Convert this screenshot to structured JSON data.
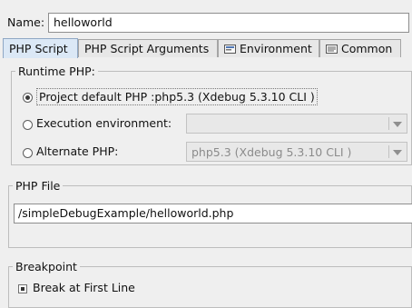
{
  "name_row": {
    "label": "Name:",
    "value": "helloworld"
  },
  "tabs": [
    {
      "label": "PHP Script",
      "icon": "php-script-icon",
      "active": true
    },
    {
      "label": "PHP Script Arguments",
      "icon": "",
      "active": false
    },
    {
      "label": "Environment",
      "icon": "environment-icon",
      "active": false
    },
    {
      "label": "Common",
      "icon": "common-icon",
      "active": false
    }
  ],
  "runtime": {
    "title": "Runtime PHP:",
    "options": [
      {
        "label": "Project default PHP :php5.3 (Xdebug 5.3.10 CLI )",
        "checked": true
      },
      {
        "label": "Execution environment:",
        "checked": false,
        "combo": ""
      },
      {
        "label": "Alternate PHP:",
        "checked": false,
        "combo": "php5.3 (Xdebug 5.3.10 CLI )"
      }
    ]
  },
  "php_file": {
    "title": "PHP File",
    "value": "/simpleDebugExample/helloworld.php"
  },
  "breakpoint": {
    "title": "Breakpoint",
    "checkbox_label": "Break at First Line"
  },
  "colors": {
    "active_tab": "#dbe8f6",
    "background": "#efefef"
  }
}
